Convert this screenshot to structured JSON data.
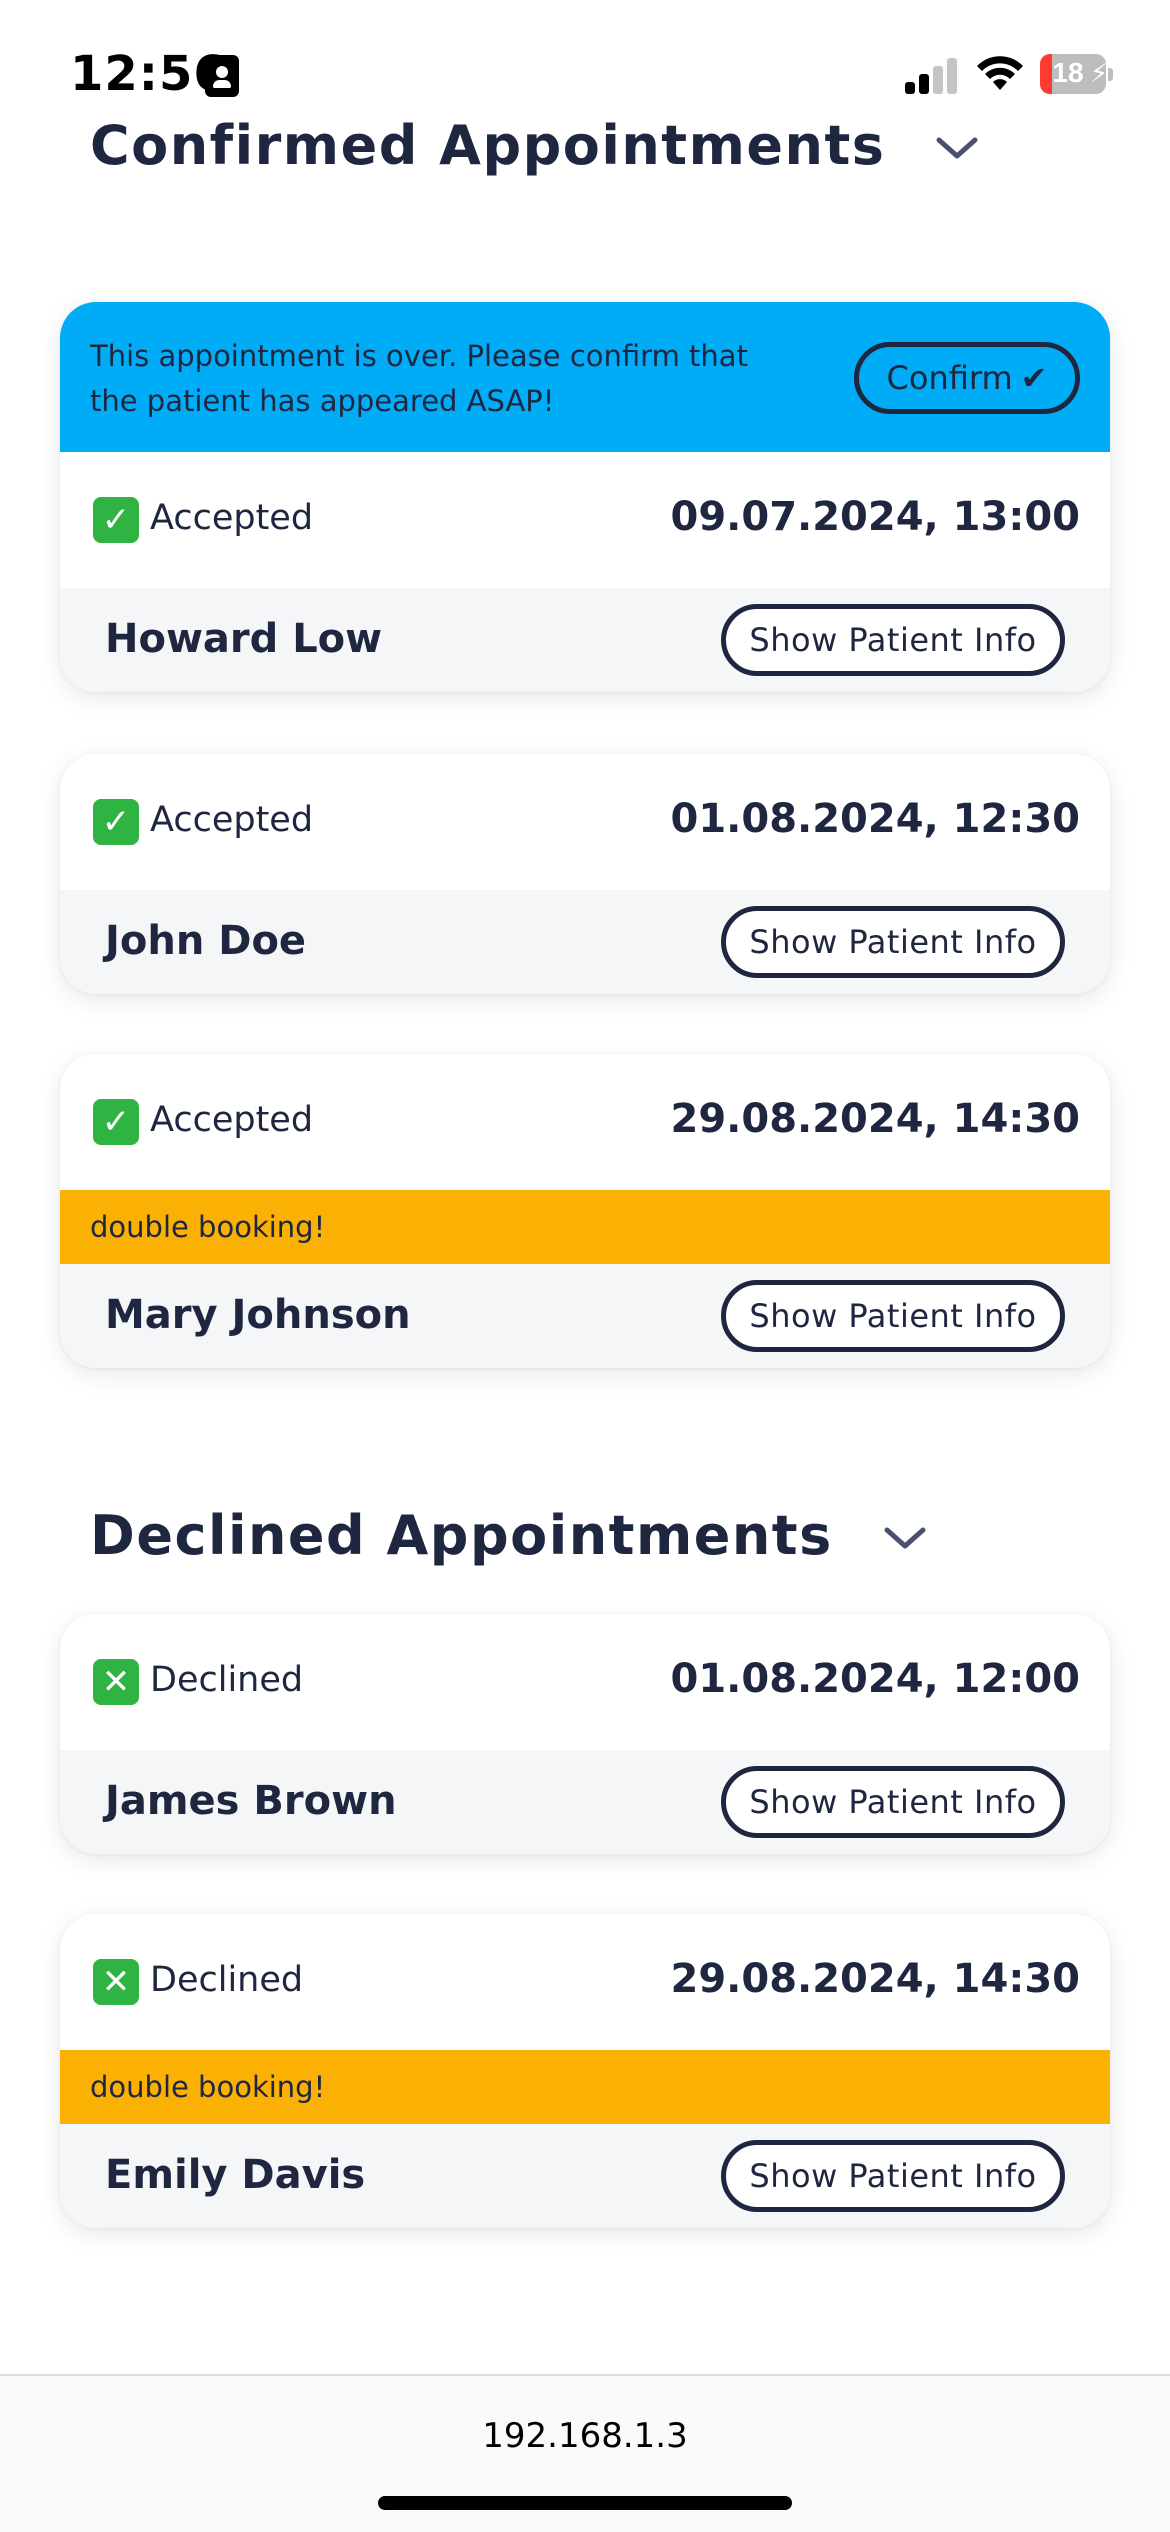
{
  "status_bar": {
    "time": "12:56",
    "battery_level": "18",
    "battery_fraction": 0.18,
    "icons": [
      "id-card-icon",
      "cellular-signal-icon",
      "wifi-icon",
      "battery-charging-icon"
    ]
  },
  "colors": {
    "notice": "#00acf5",
    "warning": "#fbb004",
    "text": "#1e2640",
    "accepted_icon": "#2fb343",
    "declined_icon": "#2fb343"
  },
  "confirmed": {
    "title": "Confirmed Appointments",
    "notice": {
      "text": "This appointment is over. Please confirm that the patient has appeared ASAP!",
      "confirm_label": "Confirm",
      "confirm_icon": "✔"
    },
    "cards": [
      {
        "status": "Accepted",
        "status_icon": "✓",
        "datetime": "09.07.2024, 13:00",
        "patient": "Howard Low",
        "button": "Show Patient Info"
      },
      {
        "status": "Accepted",
        "status_icon": "✓",
        "datetime": "01.08.2024, 12:30",
        "patient": "John Doe",
        "button": "Show Patient Info"
      },
      {
        "status": "Accepted",
        "status_icon": "✓",
        "datetime": "29.08.2024, 14:30",
        "warning": "double booking!",
        "patient": "Mary Johnson",
        "button": "Show Patient Info"
      }
    ]
  },
  "declined": {
    "title": "Declined Appointments",
    "cards": [
      {
        "status": "Declined",
        "status_icon": "✕",
        "datetime": "01.08.2024, 12:00",
        "patient": "James Brown",
        "button": "Show Patient Info"
      },
      {
        "status": "Declined",
        "status_icon": "✕",
        "datetime": "29.08.2024, 14:30",
        "warning": "double booking!",
        "patient": "Emily Davis",
        "button": "Show Patient Info"
      }
    ]
  },
  "browser": {
    "url": "192.168.1.3"
  }
}
